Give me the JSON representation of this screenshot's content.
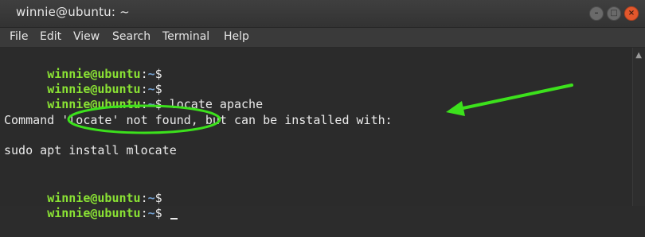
{
  "window": {
    "title": "winnie@ubuntu: ~",
    "controls": {
      "minimize": "–",
      "maximize": "□",
      "close": "×"
    }
  },
  "menubar": {
    "items": [
      "File",
      "Edit",
      "View",
      "Search",
      "Terminal",
      "Help"
    ]
  },
  "terminal": {
    "user": "winnie@ubuntu",
    "sep": ":",
    "path": "~",
    "prompt_char": "$",
    "command": "locate apache",
    "output": [
      "Command 'locate' not found, but can be installed with:",
      "sudo apt install mlocate"
    ]
  },
  "annotation": {
    "ellipse_color": "#3ce11c",
    "arrow_color": "#3ce11c"
  }
}
